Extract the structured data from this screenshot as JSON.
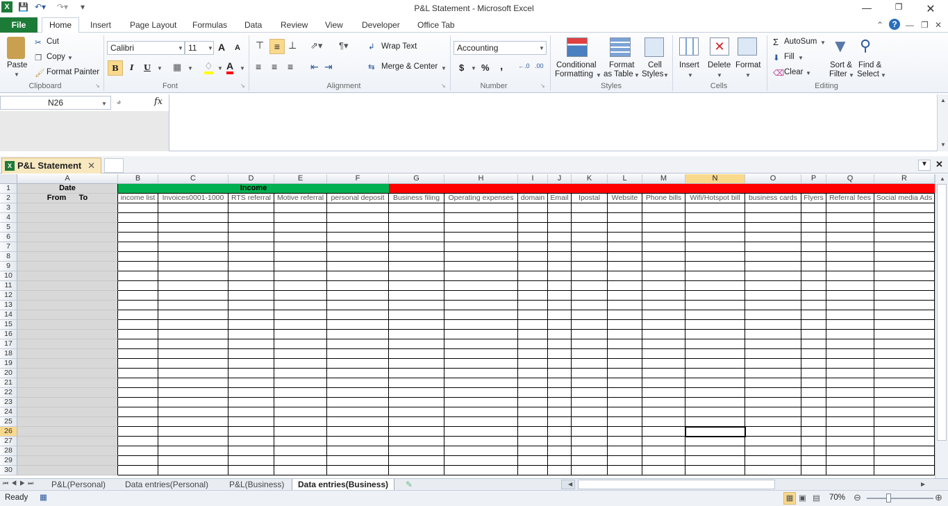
{
  "window": {
    "title": "P&L Statement  -  Microsoft Excel"
  },
  "ribbon_tabs": [
    "File",
    "Home",
    "Insert",
    "Page Layout",
    "Formulas",
    "Data",
    "Review",
    "View",
    "Developer",
    "Office Tab"
  ],
  "clipboard": {
    "paste": "Paste",
    "cut": "Cut",
    "copy": "Copy",
    "format_painter": "Format Painter",
    "label": "Clipboard"
  },
  "font": {
    "name": "Calibri",
    "size": "11",
    "bold": "B",
    "italic": "I",
    "underline": "U",
    "label": "Font",
    "grow": "A",
    "shrink": "A",
    "color_a": "A"
  },
  "alignment": {
    "wrap": "Wrap Text",
    "merge": "Merge & Center",
    "label": "Alignment"
  },
  "number": {
    "format": "Accounting",
    "currency": "$",
    "percent": "%",
    "comma": ",",
    "label": "Number"
  },
  "styles": {
    "conditional": "Conditional",
    "conditional2": "Formatting",
    "format_table": "Format",
    "format_table2": "as Table",
    "cell_styles": "Cell",
    "cell_styles2": "Styles",
    "label": "Styles"
  },
  "cells": {
    "insert": "Insert",
    "delete": "Delete",
    "format": "Format",
    "label": "Cells"
  },
  "editing": {
    "autosum": "AutoSum",
    "fill": "Fill",
    "clear": "Clear",
    "sort": "Sort &",
    "sort2": "Filter",
    "find": "Find &",
    "find2": "Select",
    "label": "Editing"
  },
  "formula_bar": {
    "name_box": "N26",
    "fx": "fx",
    "value": ""
  },
  "doc_tab": {
    "title": "P&L Statement"
  },
  "columns": [
    "A",
    "B",
    "C",
    "D",
    "E",
    "F",
    "G",
    "H",
    "I",
    "J",
    "K",
    "L",
    "M",
    "N",
    "O",
    "P",
    "Q",
    "R"
  ],
  "row1": {
    "a": "Date",
    "income": "Income"
  },
  "row2": {
    "a": "From      To",
    "headers": [
      "income list",
      "Invoices0001-1000",
      "RTS referral",
      "Motive referral",
      "personal deposit",
      "Business filing",
      "Operating expenses",
      "domain",
      "Email",
      "Ipostal",
      "Website",
      "Phone bills",
      "Wifi/Hotspot bill",
      "business cards",
      "Flyers",
      "Referral fees",
      "Social media Ads"
    ]
  },
  "row_numbers": [
    "1",
    "2",
    "3",
    "4",
    "5",
    "6",
    "7",
    "8",
    "9",
    "10",
    "11",
    "12",
    "13",
    "14",
    "15",
    "16",
    "17",
    "18",
    "19",
    "20",
    "21",
    "22",
    "23",
    "24",
    "25",
    "26",
    "27",
    "28",
    "29",
    "30"
  ],
  "sheets": [
    "P&L(Personal)",
    "Data entries(Personal)",
    "P&L(Business)",
    "Data entries(Business)"
  ],
  "active_sheet": "Data entries(Business)",
  "status": {
    "ready": "Ready",
    "zoom": "70%"
  },
  "colors": {
    "income": "#00b050",
    "expense": "#ff0000",
    "file_tab": "#1d7b38",
    "selection": "#f9d98c"
  }
}
